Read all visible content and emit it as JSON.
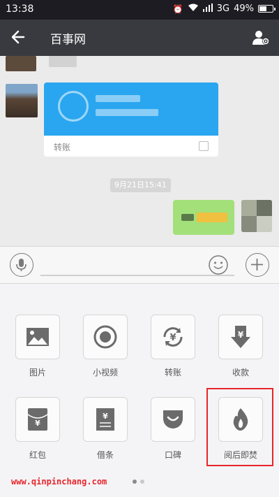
{
  "status_bar": {
    "time": "13:38",
    "network": "3G",
    "battery": "49%"
  },
  "nav": {
    "title": "百事网",
    "back_icon": "arrow-left-icon",
    "profile_icon": "user-settings-icon"
  },
  "chat": {
    "transfer_card": {
      "label": "转账"
    },
    "timestamp": "9月21日15:41"
  },
  "input_bar": {
    "voice_icon": "microphone-icon",
    "emoji_icon": "smiley-icon",
    "more_icon": "plus-icon"
  },
  "panel": {
    "items": [
      {
        "label": "图片",
        "icon": "image-icon"
      },
      {
        "label": "小视频",
        "icon": "video-record-icon"
      },
      {
        "label": "转账",
        "icon": "transfer-icon"
      },
      {
        "label": "收款",
        "icon": "receive-money-icon"
      },
      {
        "label": "红包",
        "icon": "red-envelope-icon"
      },
      {
        "label": "借条",
        "icon": "iou-note-icon"
      },
      {
        "label": "口碑",
        "icon": "koubei-icon"
      },
      {
        "label": "阅后即焚",
        "icon": "flame-icon"
      }
    ],
    "watermark": "www.qinpinchang.com",
    "page_count": 2,
    "active_page": 1
  },
  "colors": {
    "nav_bg": "#393a3f",
    "transfer_blue": "#2aa6f0",
    "sent_bubble": "#a3e07a",
    "highlight_red": "#e8262c"
  }
}
